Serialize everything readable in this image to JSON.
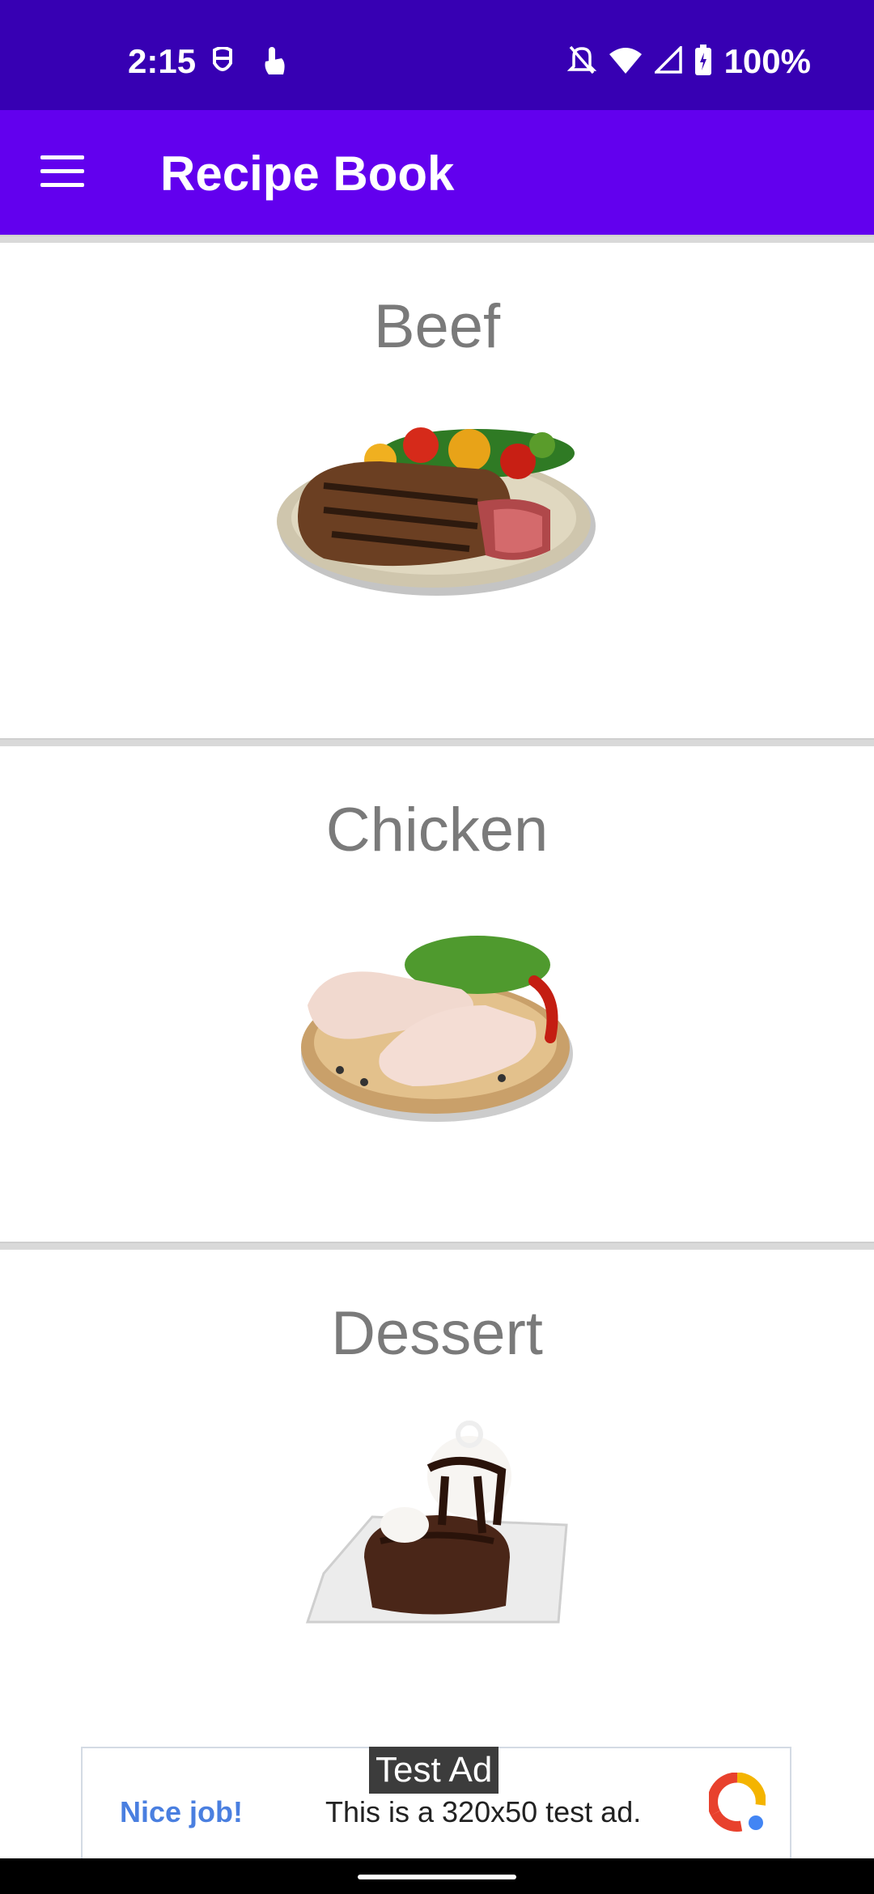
{
  "status_bar": {
    "time": "2:15",
    "battery": "100%",
    "icons": [
      "face-unlock-icon",
      "touch-icon",
      "bell-off-icon",
      "wifi-icon",
      "signal-icon",
      "battery-icon"
    ]
  },
  "app_bar": {
    "title": "Recipe Book",
    "menu_icon": "hamburger-menu-icon"
  },
  "categories": [
    {
      "title": "Beef",
      "image": "steak-plate-image"
    },
    {
      "title": "Chicken",
      "image": "chicken-legs-board-image"
    },
    {
      "title": "Dessert",
      "image": "chocolate-brownie-image"
    }
  ],
  "ad": {
    "badge": "Test Ad",
    "headline": "Nice job!",
    "body": "This is a 320x50 test ad.",
    "logo": "admob-logo-icon"
  },
  "colors": {
    "status_bar": "#3700B3",
    "app_bar": "#6200EE",
    "card_title": "#7a7a7a"
  }
}
